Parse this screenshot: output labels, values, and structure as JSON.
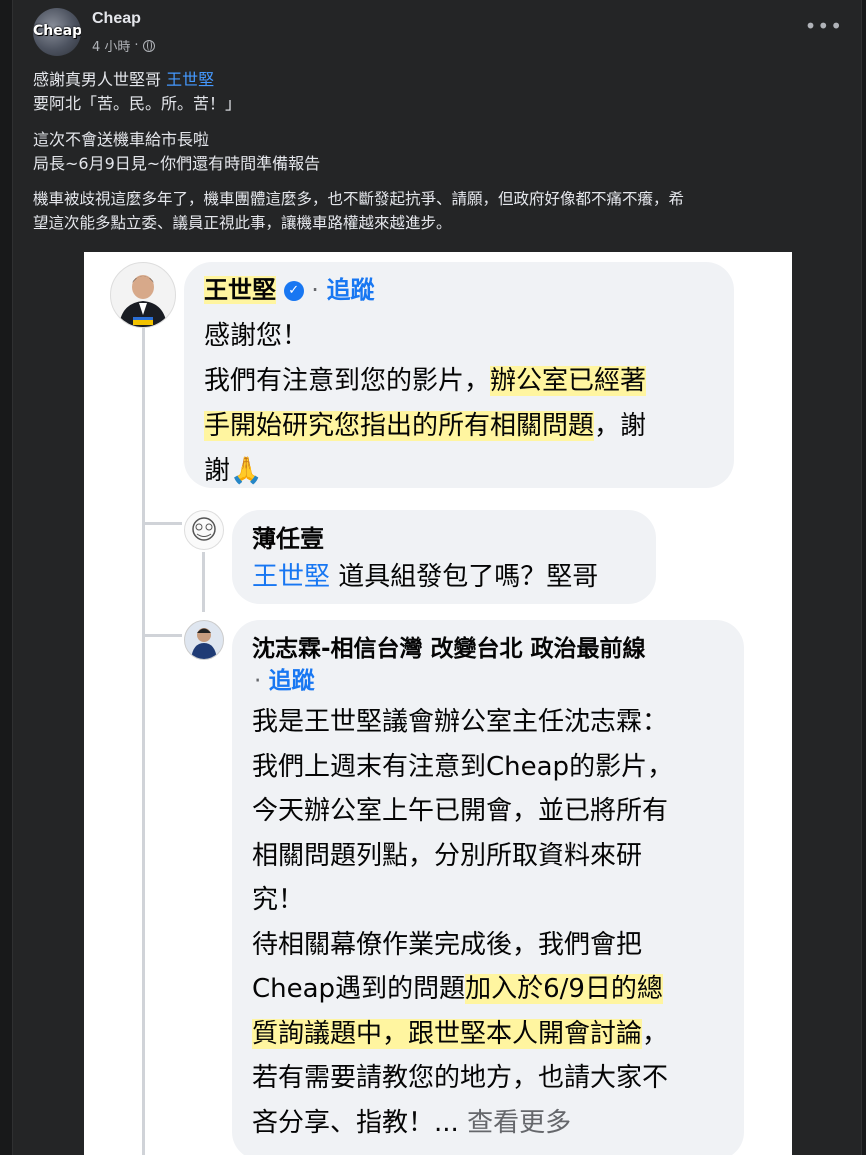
{
  "post": {
    "author": "Cheap",
    "avatar_text": "Cheap",
    "time": "4 小時",
    "separator": "·",
    "privacy_icon": "globe-icon",
    "more_icon": "•••",
    "line1_text": "感謝真男人世堅哥 ",
    "line1_link": "王世堅",
    "line2": "要阿北「苦。民。所。苦！」",
    "line3": "這次不會送機車給市長啦",
    "line4": "局長~6月9日見~你們還有時間準備報告",
    "para1": "機車被歧視這麼多年了，機車團體這麼多，也不斷發起抗爭、請願，但政府好像都不痛不癢，希",
    "para2": "望這次能多點立委、議員正視此事，讓機車路權越來越進步。"
  },
  "image": {
    "comment1": {
      "name": "王世堅",
      "follow_sep": "·",
      "follow": "追蹤",
      "l1": "感謝您！",
      "l2a": "我們有注意到您的影片，",
      "l2b": "辦公室已經著",
      "l3a": "手開始研究您指出的所有相關問題",
      "l3b": "，謝",
      "l4": "謝🙏"
    },
    "reply1": {
      "name": "薄任壹",
      "mention": "王世堅",
      "text": " 道具組發包了嗎？堅哥"
    },
    "reply2": {
      "name": "沈志霖-相信台灣 改變台北 政治最前線",
      "follow_sep": "·",
      "follow": "追蹤",
      "l1": "我是王世堅議會辦公室主任沈志霖：",
      "l2": "我們上週末有注意到Cheap的影片，",
      "l3": "今天辦公室上午已開會，並已將所有",
      "l4": "相關問題列點，分別所取資料來研",
      "l5": "究！",
      "l6": "待相關幕僚作業完成後，我們會把",
      "l7a": "Cheap遇到的問題",
      "l7b": "加入於6/9日的總",
      "l8a": "質詢議題中，跟世堅本人開會討論",
      "l8b": "，",
      "l9": "若有需要請教您的地方，也請大家不",
      "l10a": "吝分享、指教！... ",
      "l10b": "查看更多"
    }
  }
}
